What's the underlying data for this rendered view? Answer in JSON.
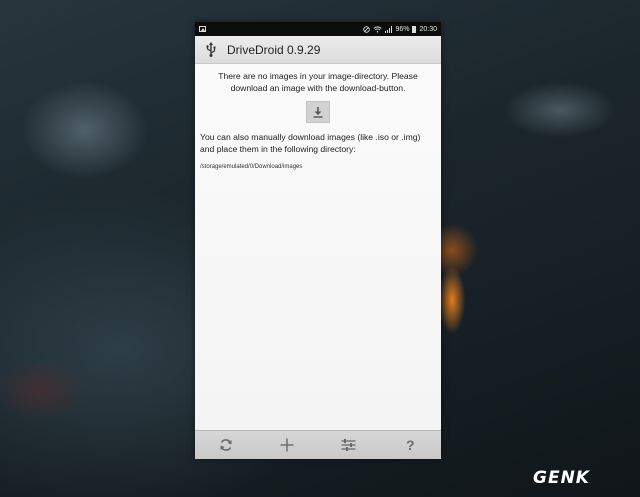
{
  "statusbar": {
    "battery": "96%",
    "time": "20:30"
  },
  "app": {
    "title": "DriveDroid 0.9.29"
  },
  "content": {
    "no_images_message": "There are no images in your image-directory. Please download an image with the download-button.",
    "manual_message": "You can also manually download images (like .iso or .img) and place them in the following directory:",
    "directory_path": "/storage/emulated/0/Download/images"
  },
  "toolbar": {
    "icons": [
      "refresh-icon",
      "add-icon",
      "settings-sliders-icon",
      "help-icon"
    ],
    "help_label": "?"
  },
  "watermark": {
    "text": "GENK"
  },
  "colors": {
    "status_bar": "#0c0c0c",
    "app_bar": "#e4e4e4",
    "content_bg": "#f6f6f6",
    "bottom_bar": "#cfcfcf",
    "icon_gray": "#6a6a6a"
  }
}
